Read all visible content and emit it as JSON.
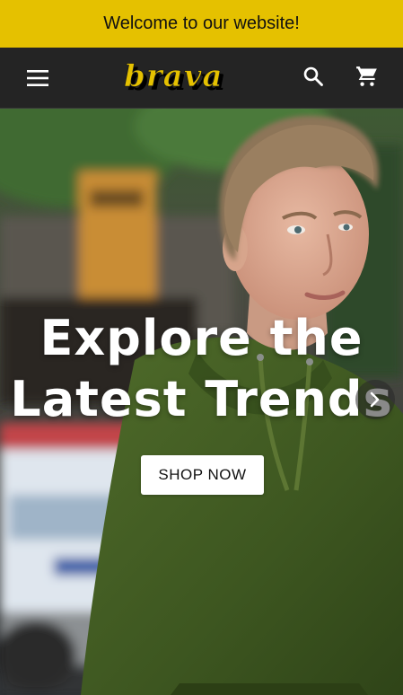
{
  "announcement": {
    "text": "Welcome to our website!",
    "background": "#e5c100"
  },
  "header": {
    "background": "#242424",
    "menu_icon": "hamburger-menu-icon",
    "logo_text": "brava",
    "logo_color": "#e5c100",
    "search_icon": "search-icon",
    "cart_icon": "shopping-cart-icon"
  },
  "hero": {
    "title_line1": "Explore the",
    "title_line2": "Latest Trends",
    "cta_label": "SHOP NOW",
    "next_icon": "chevron-right-icon",
    "image_description_icon": "hero-photo"
  }
}
